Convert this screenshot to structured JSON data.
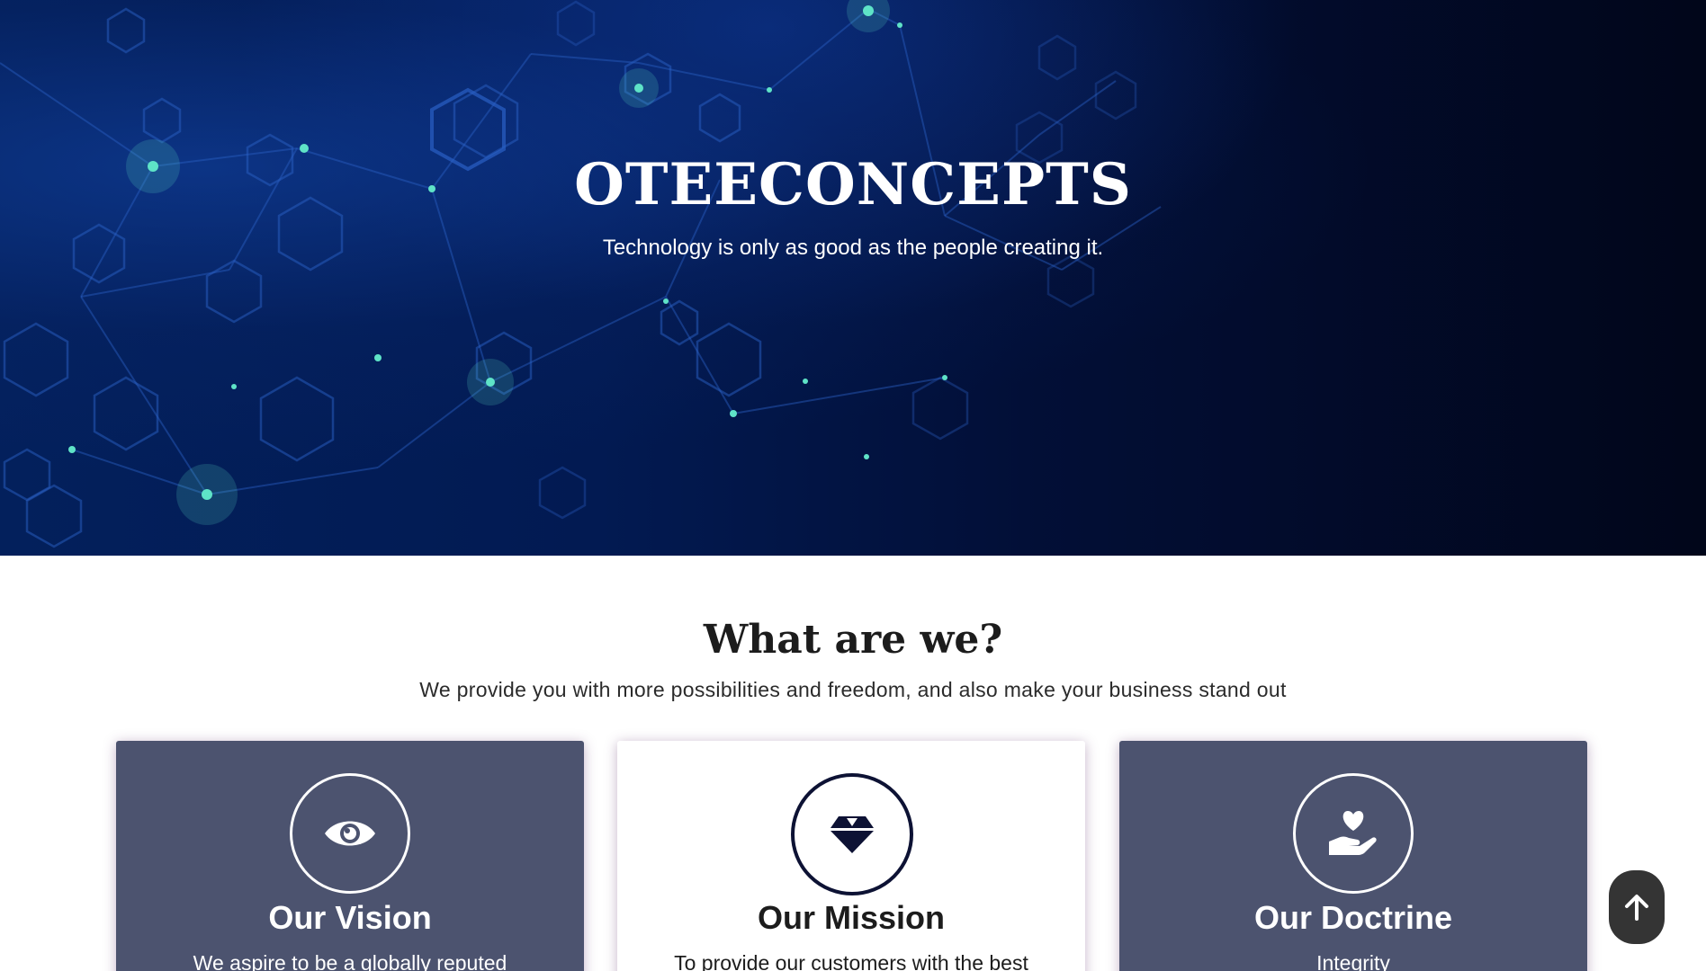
{
  "hero": {
    "title": "OTEECONCEPTS",
    "tagline": "Technology is only as good as the people creating it."
  },
  "about": {
    "title": "What are we?",
    "subtitle": "We provide you with more possibilities and freedom, and also make your business stand out"
  },
  "cards": [
    {
      "title": "Our Vision",
      "text": "We aspire to be a globally reputed",
      "icon": "eye-icon"
    },
    {
      "title": "Our Mission",
      "text": "To provide our customers with the best",
      "icon": "diamond-icon"
    },
    {
      "title": "Our Doctrine",
      "text": "Integrity",
      "icon": "hand-holding-heart-icon"
    }
  ],
  "scroll_top": {
    "icon": "arrow-up-icon"
  },
  "colors": {
    "hero_dark": "#01061a",
    "hero_blue": "#03205c",
    "card_dark": "#4c536f",
    "card_light": "#ffffff",
    "icon_navy": "#0d1234",
    "scroll_button": "#343434"
  }
}
